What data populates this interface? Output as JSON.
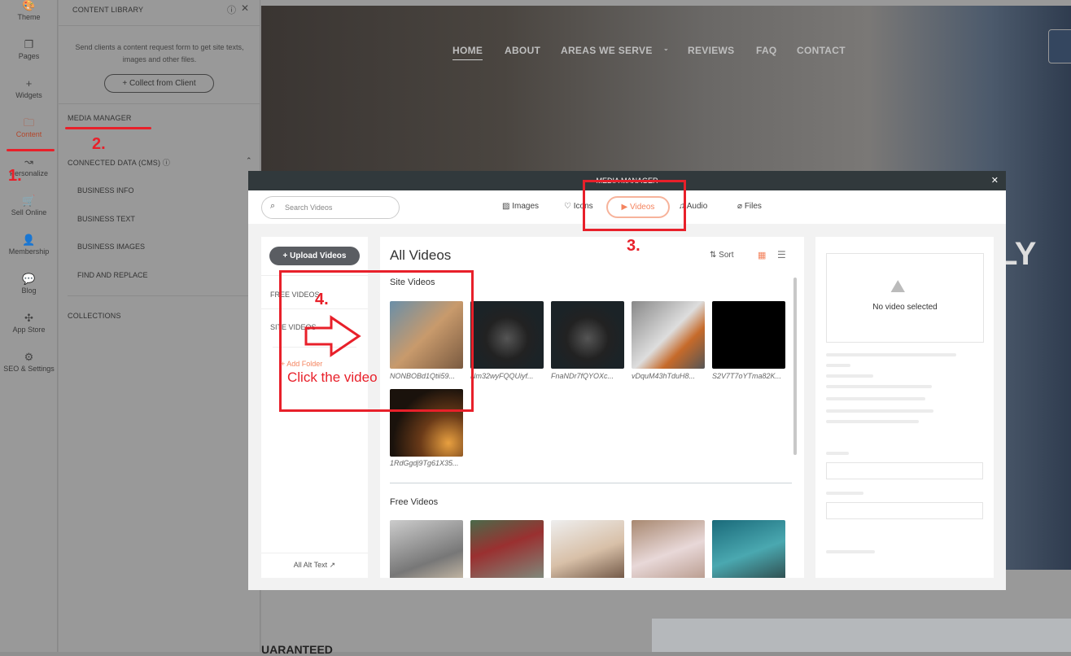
{
  "rail": [
    {
      "label": "Theme",
      "icon": "palette-icon"
    },
    {
      "label": "Pages",
      "icon": "pages-icon"
    },
    {
      "label": "Widgets",
      "icon": "plus-icon"
    },
    {
      "label": "Content",
      "icon": "folder-icon"
    },
    {
      "label": "Personalize",
      "icon": "route-icon"
    },
    {
      "label": "Sell Online",
      "icon": "cart-icon"
    },
    {
      "label": "Membership",
      "icon": "user-icon"
    },
    {
      "label": "Blog",
      "icon": "chat-icon"
    },
    {
      "label": "App Store",
      "icon": "puzzle-icon"
    },
    {
      "label": "SEO & Settings",
      "icon": "gear-icon"
    }
  ],
  "library": {
    "title": "CONTENT LIBRARY",
    "description": "Send clients a content request form to get site texts, images and other files.",
    "collect_button": "+ Collect from Client",
    "media_manager": "MEDIA MANAGER",
    "connected_data": "CONNECTED DATA (CMS)",
    "sub_items": [
      "BUSINESS INFO",
      "BUSINESS TEXT",
      "BUSINESS IMAGES",
      "FIND AND REPLACE"
    ],
    "collections": "COLLECTIONS"
  },
  "site": {
    "nav": [
      "HOME",
      "ABOUT",
      "AREAS WE SERVE",
      "REVIEWS",
      "FAQ",
      "CONTACT"
    ],
    "hero_fragment": "LY",
    "bottom_fragment": "UARANTEED"
  },
  "modal": {
    "title": "MEDIA MANAGER",
    "search_placeholder": "Search Videos",
    "tabs": [
      "Images",
      "Icons",
      "Videos",
      "Audio",
      "Files"
    ],
    "active_tab": "Videos",
    "upload_button": "+ Upload Videos",
    "folders": [
      "FREE VIDEOS",
      "SITE VIDEOS"
    ],
    "add_folder": "+ Add Folder",
    "alt_text": "All Alt Text",
    "heading": "All Videos",
    "sort": "Sort",
    "site_videos_heading": "Site Videos",
    "site_videos": [
      "NONBOBd1Qtii59...",
      "Nm32wyFQQUiyf...",
      "FnaNDr7fQYOXc...",
      "vDquM43hTduH8...",
      "S2V7T7oYTma82K...",
      "1RdGgdj9Tg61X35..."
    ],
    "free_videos_heading": "Free Videos",
    "free_videos_count": 5,
    "no_selection": "No video selected",
    "accent": "#f4845f"
  },
  "annotations": {
    "step1": "1.",
    "step2": "2.",
    "step3": "3.",
    "step4": "4.",
    "instruction": "Click the video",
    "color": "#e8202a"
  }
}
